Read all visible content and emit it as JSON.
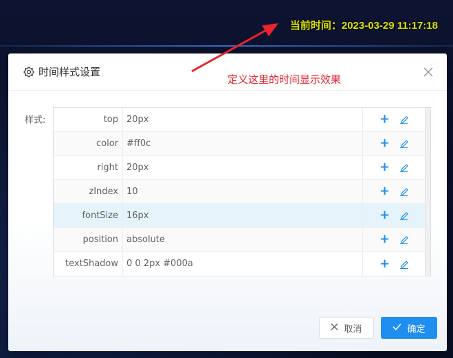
{
  "background": {
    "clock_label": "当前时间：2023-03-29 11:17:18"
  },
  "annotation": {
    "text": "定义这里的时间显示效果"
  },
  "dialog": {
    "title": "时间样式设置",
    "form_label": "样式:",
    "rows": [
      {
        "key": "top",
        "value": "20px"
      },
      {
        "key": "color",
        "value": "#ff0c"
      },
      {
        "key": "right",
        "value": "20px"
      },
      {
        "key": "zIndex",
        "value": "10"
      },
      {
        "key": "fontSize",
        "value": "16px"
      },
      {
        "key": "position",
        "value": "absolute"
      },
      {
        "key": "textShadow",
        "value": "0 0 2px #000a"
      }
    ],
    "cancel_label": "取消",
    "ok_label": "确定"
  },
  "colors": {
    "clock": "#d8e000",
    "annotation": "#e8232d",
    "primary": "#1e8ff0",
    "highlight_row": "#e5f3fb"
  }
}
